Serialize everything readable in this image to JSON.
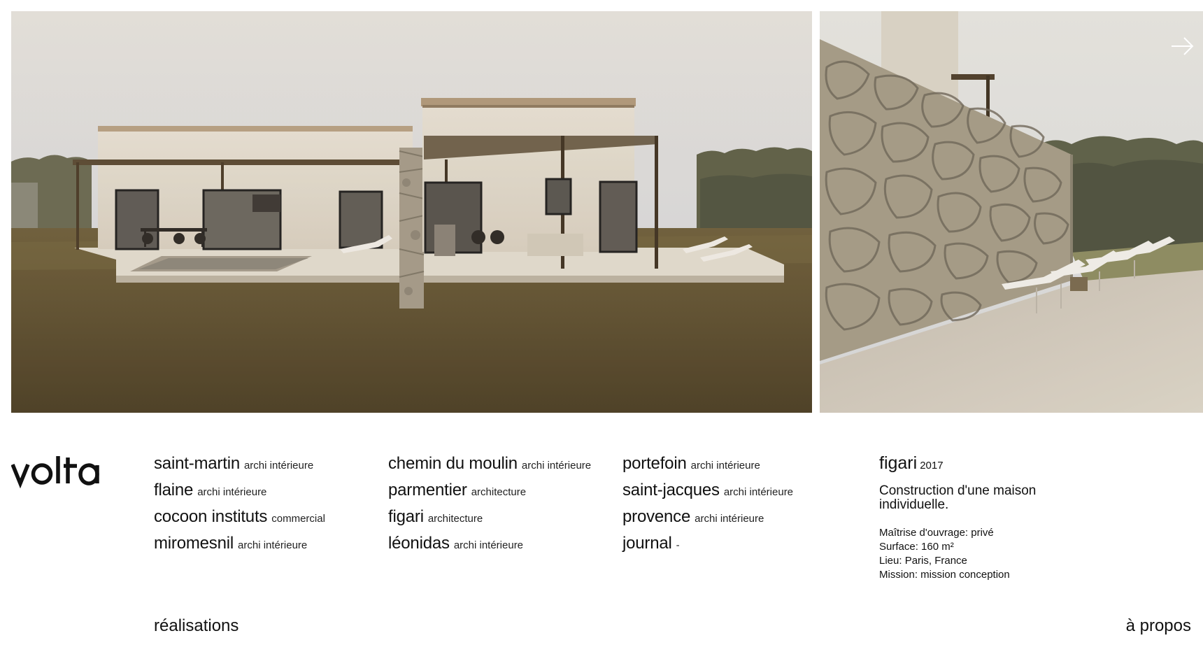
{
  "brand": {
    "logo_text": "volta"
  },
  "gallery": {
    "images": [
      {
        "subject": "figari house exterior rendering with pool and terrace"
      },
      {
        "subject": "figari stone wall with sun loungers"
      }
    ],
    "next_icon": "arrow-right-icon"
  },
  "projects": {
    "columns": [
      [
        {
          "name": "saint-martin",
          "type": "archi intérieure"
        },
        {
          "name": "flaine",
          "type": "archi intérieure"
        },
        {
          "name": "cocoon instituts",
          "type": "commercial"
        },
        {
          "name": "miromesnil",
          "type": "archi intérieure"
        }
      ],
      [
        {
          "name": "chemin du moulin",
          "type": "archi intérieure"
        },
        {
          "name": "parmentier",
          "type": "architecture"
        },
        {
          "name": "figari",
          "type": "architecture"
        },
        {
          "name": "léonidas",
          "type": "archi intérieure"
        }
      ],
      [
        {
          "name": "portefoin",
          "type": "archi intérieure"
        },
        {
          "name": "saint-jacques",
          "type": "archi intérieure"
        },
        {
          "name": "provence",
          "type": "archi intérieure"
        },
        {
          "name": "journal",
          "type": "-"
        }
      ]
    ]
  },
  "detail": {
    "name": "figari",
    "year": "2017",
    "description": "Construction d'une maison individuelle.",
    "specs": [
      "Maîtrise d'ouvrage: privé",
      "Surface: 160 m²",
      "Lieu: Paris, France",
      "Mission: mission conception"
    ]
  },
  "nav": {
    "realisations": "réalisations",
    "apropos": "à propos"
  }
}
